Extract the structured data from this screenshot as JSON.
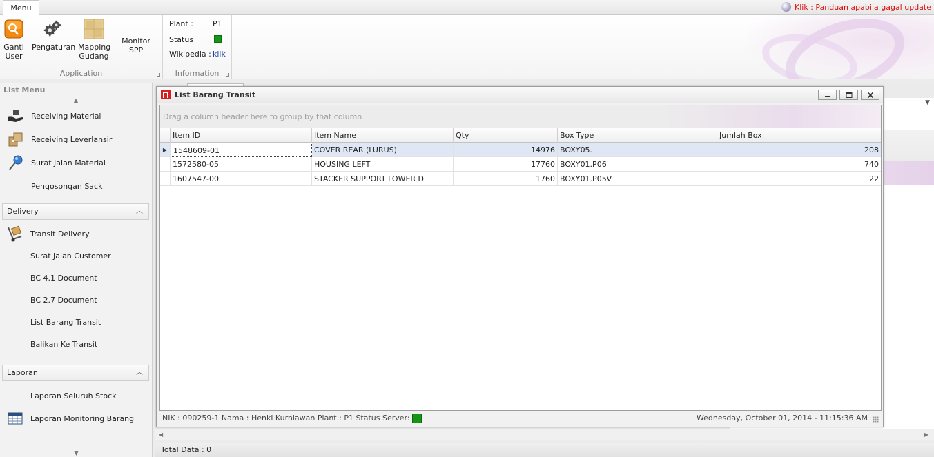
{
  "ribbon": {
    "tab_menu": "Menu",
    "update_link": "Klik : Panduan apabila gagal update",
    "application": {
      "label": "Application",
      "buttons": [
        {
          "line1": "Ganti",
          "line2": "User",
          "icon": "ganti-user-icon"
        },
        {
          "line1": "Pengaturan",
          "line2": "",
          "icon": "gears-icon"
        },
        {
          "line1": "Mapping",
          "line2": "Gudang",
          "icon": "warehouse-boxes-icon"
        },
        {
          "line1": "Monitor SPP",
          "line2": "",
          "icon": ""
        }
      ]
    },
    "information": {
      "label": "Information",
      "plant_label": "Plant :",
      "plant_value": "P1",
      "status_label": "Status",
      "wiki_label": "Wikipedia :",
      "wiki_link": "klik",
      "status_color": "#169516"
    }
  },
  "left_menu": {
    "title": "List Menu",
    "receiving_items": [
      {
        "label": "Receiving Material",
        "icon": "hand-box-icon"
      },
      {
        "label": "Receiving Leverlansir",
        "icon": "boxes-icon"
      },
      {
        "label": "Surat Jalan Material",
        "icon": "pin-icon"
      },
      {
        "label": "Pengosongan Sack",
        "icon": ""
      }
    ],
    "delivery": {
      "title": "Delivery",
      "items": [
        {
          "label": "Transit Delivery",
          "icon": "hand-truck-icon"
        },
        {
          "label": "Surat Jalan Customer",
          "icon": ""
        },
        {
          "label": "BC 4.1 Document",
          "icon": ""
        },
        {
          "label": "BC 2.7 Document",
          "icon": ""
        },
        {
          "label": "List Barang Transit",
          "icon": ""
        },
        {
          "label": "Balikan Ke Transit",
          "icon": ""
        }
      ]
    },
    "laporan": {
      "title": "Laporan",
      "items": [
        {
          "label": "Laporan Seluruh Stock",
          "icon": ""
        },
        {
          "label": "Laporan Monitoring Barang",
          "icon": "table-icon"
        }
      ]
    }
  },
  "window": {
    "title": "List Barang Transit",
    "group_panel_text": "Drag a column header here to group by that column",
    "columns": [
      "Item ID",
      "Item Name",
      "Qty",
      "Box Type",
      "Jumlah Box"
    ],
    "rows": [
      {
        "item_id": "1548609-01",
        "item_name": "COVER REAR (LURUS)",
        "qty": "14976",
        "box_type": "BOXY05.",
        "jumlah_box": "208"
      },
      {
        "item_id": "1572580-05",
        "item_name": "HOUSING LEFT",
        "qty": "17760",
        "box_type": "BOXY01.P06",
        "jumlah_box": "740"
      },
      {
        "item_id": "1607547-00",
        "item_name": "STACKER SUPPORT LOWER D",
        "qty": "1760",
        "box_type": "BOXY01.P05V",
        "jumlah_box": "22"
      }
    ],
    "status": {
      "nik_label": "NIK :",
      "nik": "090259-1",
      "nama_label": "Nama :",
      "nama": "Henki Kurniawan",
      "plant_label": "Plant :",
      "plant": "P1",
      "server_label": "Status Server:",
      "datetime": "Wednesday, October 01, 2014 - 11:15:36 AM"
    }
  },
  "footer": {
    "total_data": "Total Data : 0"
  }
}
